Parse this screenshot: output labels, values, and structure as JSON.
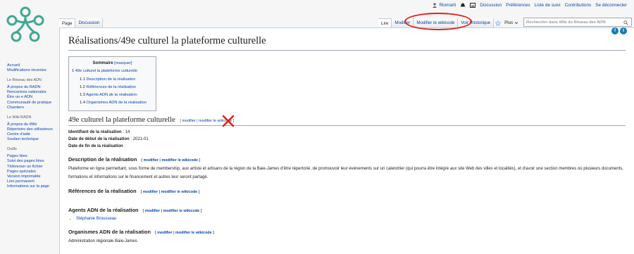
{
  "personal": {
    "user": "Riomarti",
    "discussion": "Discussion",
    "preferences": "Préférences",
    "watchlist": "Liste de suivi",
    "contributions": "Contributions",
    "logout": "Se déconnecter"
  },
  "tabs_left": [
    "Page",
    "Discussion"
  ],
  "tabs_right": {
    "read": "Lire",
    "edit": "Modifier",
    "edit_source": "Modifier le wikicode",
    "history": "Voir l'historique",
    "more": "Plus"
  },
  "search": {
    "placeholder": "Rechercher dans Wiki du Réseau des ADN"
  },
  "sidebar": {
    "main": [
      "Accueil",
      "Modifications récentes"
    ],
    "reseau_header": "Le Réseau des ADN",
    "reseau": [
      "À propos du RADN",
      "Rencontres nationales",
      "Être un·e ADN",
      "Communauté de pratique",
      "Chantiers"
    ],
    "wiki_header": "Le Wiki RADN",
    "wiki": [
      "À propos du Wiki",
      "Répertoire des utilisateurs",
      "Centre d'aide",
      "Soutien technique"
    ],
    "tools_header": "Outils",
    "tools": [
      "Pages liées",
      "Suivi des pages liées",
      "Téléverser un fichier",
      "Pages spéciales",
      "Version imprimable",
      "Lien permanent",
      "Informations sur la page"
    ]
  },
  "page": {
    "title": "Réalisations/49e culturel la plateforme culturelle",
    "toc": {
      "title": "Sommaire",
      "toggle": "[masquer]",
      "items": [
        {
          "num": "1",
          "label": "49e culturel la plateforme culturelle",
          "level": 1
        },
        {
          "num": "1.1",
          "label": "Description de la réalisation",
          "level": 2
        },
        {
          "num": "1.2",
          "label": "Références de la réalisation",
          "level": 2
        },
        {
          "num": "1.3",
          "label": "Agents ADN de la réalisation",
          "level": 2
        },
        {
          "num": "1.4",
          "label": "Organismes ADN de la réalisation",
          "level": 2
        }
      ]
    },
    "section_title": "49e culturel la plateforme culturelle",
    "edit_links": {
      "open": "[",
      "modify": "modifier",
      "sep": " | ",
      "modify_source": "modifier le wikicode",
      "close": "]"
    },
    "fields": {
      "id_label": "Identifiant de la réalisation",
      "id_value": ": 14",
      "start_label": "Date de début de la réalisation",
      "start_value": ": 2021-01",
      "end_label": "Date de fin de la réalisation",
      "end_value": ":"
    },
    "description_title": "Description de la réalisation",
    "description_text": "Plateforme en ligne permettant, sous forme de membership, aux artiste et artisans de la région de la Baie-James d'être répertorié, de promouvoir leur événements sur un calendrier (qui pourra être intégré aux site Web des villes et localités), et d'avoir une section membres où plusieurs documents, formations et informations sur le financement et autres leur seront partagé.",
    "references_title": "Références de la réalisation",
    "agents_title": "Agents ADN de la réalisation",
    "agents": [
      "Stéphanie Brousseau"
    ],
    "orgs_title": "Organismes ADN de la réalisation",
    "orgs_text": "Administration régionale Baie-James"
  },
  "colors": {
    "annotation_red": "#e0221a",
    "link": "#0645ad",
    "logo_green": "#3ea891"
  }
}
